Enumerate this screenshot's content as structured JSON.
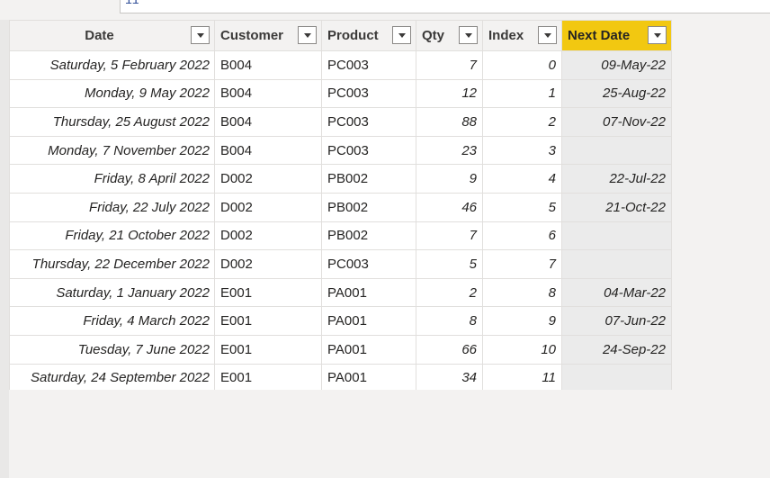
{
  "formula": {
    "text": "11"
  },
  "columns": [
    {
      "key": "date",
      "label": "Date"
    },
    {
      "key": "customer",
      "label": "Customer"
    },
    {
      "key": "product",
      "label": "Product"
    },
    {
      "key": "qty",
      "label": "Qty"
    },
    {
      "key": "index",
      "label": "Index"
    },
    {
      "key": "next_date",
      "label": "Next Date"
    }
  ],
  "rows": [
    {
      "date": "Saturday, 5 February 2022",
      "customer": "B004",
      "product": "PC003",
      "qty": "7",
      "index": "0",
      "next_date": "09-May-22"
    },
    {
      "date": "Monday, 9 May 2022",
      "customer": "B004",
      "product": "PC003",
      "qty": "12",
      "index": "1",
      "next_date": "25-Aug-22"
    },
    {
      "date": "Thursday, 25 August 2022",
      "customer": "B004",
      "product": "PC003",
      "qty": "88",
      "index": "2",
      "next_date": "07-Nov-22"
    },
    {
      "date": "Monday, 7 November 2022",
      "customer": "B004",
      "product": "PC003",
      "qty": "23",
      "index": "3",
      "next_date": ""
    },
    {
      "date": "Friday, 8 April 2022",
      "customer": "D002",
      "product": "PB002",
      "qty": "9",
      "index": "4",
      "next_date": "22-Jul-22"
    },
    {
      "date": "Friday, 22 July 2022",
      "customer": "D002",
      "product": "PB002",
      "qty": "46",
      "index": "5",
      "next_date": "21-Oct-22"
    },
    {
      "date": "Friday, 21 October 2022",
      "customer": "D002",
      "product": "PB002",
      "qty": "7",
      "index": "6",
      "next_date": ""
    },
    {
      "date": "Thursday, 22 December 2022",
      "customer": "D002",
      "product": "PC003",
      "qty": "5",
      "index": "7",
      "next_date": ""
    },
    {
      "date": "Saturday, 1 January 2022",
      "customer": "E001",
      "product": "PA001",
      "qty": "2",
      "index": "8",
      "next_date": "04-Mar-22"
    },
    {
      "date": "Friday, 4 March 2022",
      "customer": "E001",
      "product": "PA001",
      "qty": "8",
      "index": "9",
      "next_date": "07-Jun-22"
    },
    {
      "date": "Tuesday, 7 June 2022",
      "customer": "E001",
      "product": "PA001",
      "qty": "66",
      "index": "10",
      "next_date": "24-Sep-22"
    },
    {
      "date": "Saturday, 24 September 2022",
      "customer": "E001",
      "product": "PA001",
      "qty": "34",
      "index": "11",
      "next_date": ""
    }
  ],
  "colors": {
    "highlight_header": "#f2c811",
    "new_column_cells": "#ebebeb"
  },
  "icons": {
    "filter": "chevron-down-icon"
  }
}
